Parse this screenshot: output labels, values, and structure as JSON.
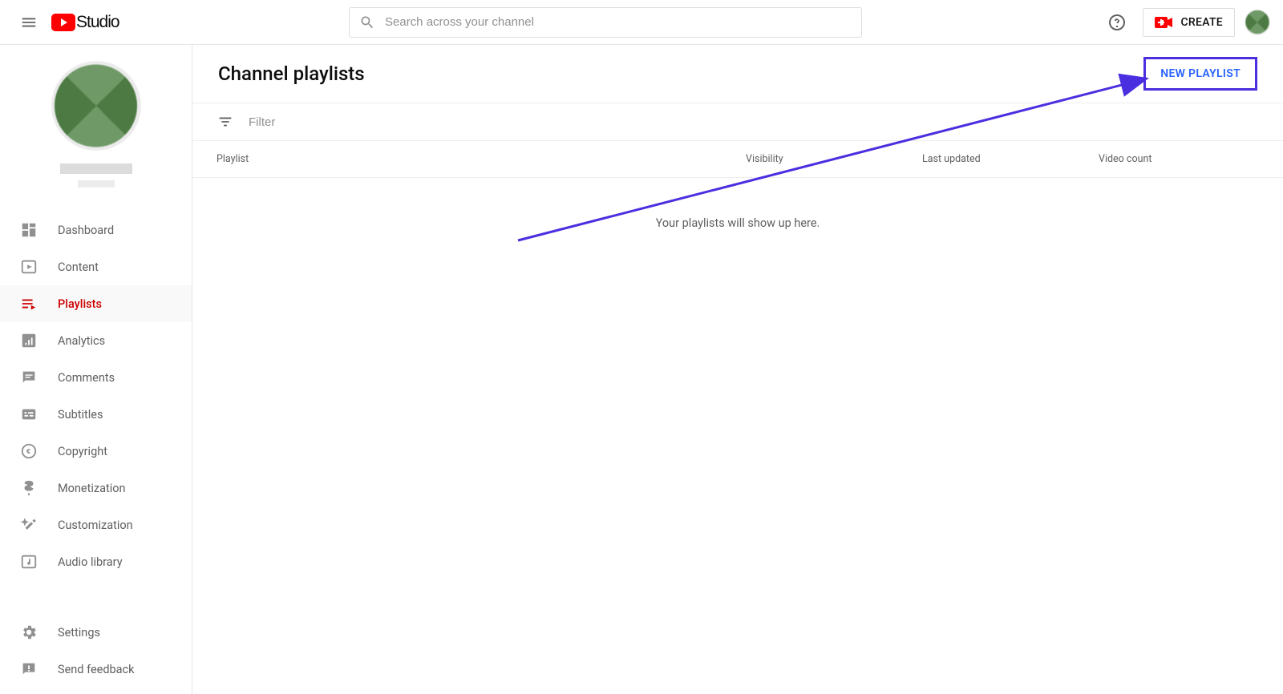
{
  "header": {
    "logo_text": "Studio",
    "search_placeholder": "Search across your channel",
    "create_label": "CREATE"
  },
  "sidebar": {
    "items": [
      {
        "label": "Dashboard"
      },
      {
        "label": "Content"
      },
      {
        "label": "Playlists"
      },
      {
        "label": "Analytics"
      },
      {
        "label": "Comments"
      },
      {
        "label": "Subtitles"
      },
      {
        "label": "Copyright"
      },
      {
        "label": "Monetization"
      },
      {
        "label": "Customization"
      },
      {
        "label": "Audio library"
      }
    ],
    "bottom": [
      {
        "label": "Settings"
      },
      {
        "label": "Send feedback"
      }
    ]
  },
  "main": {
    "title": "Channel playlists",
    "new_playlist_label": "NEW PLAYLIST",
    "filter_placeholder": "Filter",
    "columns": {
      "playlist": "Playlist",
      "visibility": "Visibility",
      "last_updated": "Last updated",
      "video_count": "Video count"
    },
    "empty_message": "Your playlists will show up here."
  }
}
